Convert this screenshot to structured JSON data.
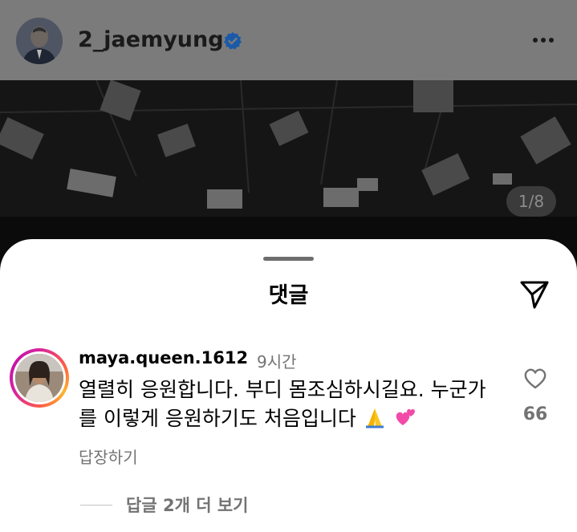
{
  "post": {
    "username": "2_jaemyung",
    "verified": true,
    "page_counter": "1/8"
  },
  "comments_sheet": {
    "title": "댓글",
    "comment": {
      "username": "maya.queen.1612",
      "time": "9시간",
      "text": "열렬히 응원합니다. 부디 몸조심하시길요. 누군가를 이렇게 응원하기도 처음입니다",
      "emojis": [
        "folded-hands-emoji",
        "two-hearts-emoji"
      ],
      "reply_label": "답장하기",
      "like_count": "66",
      "view_replies_label": "답글 2개 더 보기"
    }
  },
  "colors": {
    "verified_blue": "#1a69c9",
    "secondary_text": "#737373",
    "dim_overlay": "#7b7b7b"
  },
  "icons": [
    "verified-badge-icon",
    "more-options-icon",
    "send-icon",
    "heart-icon"
  ]
}
